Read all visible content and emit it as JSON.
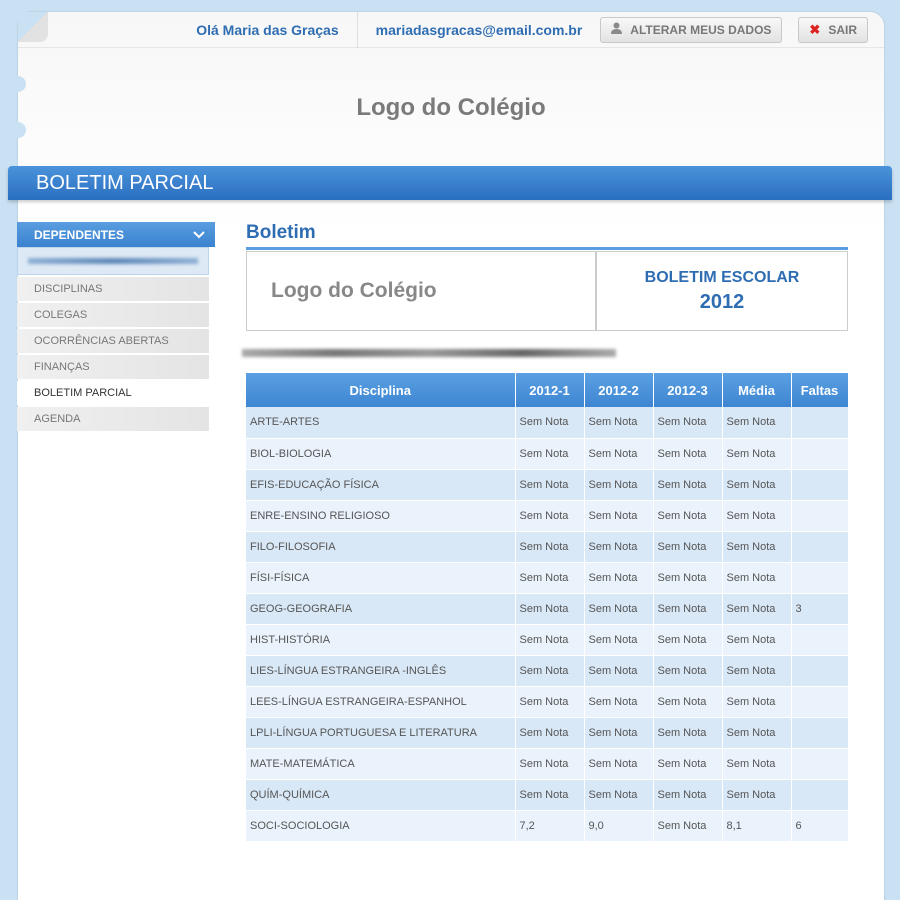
{
  "topbar": {
    "greeting": "Olá Maria das Graças",
    "email": "mariadasgracas@email.com.br",
    "edit_label": "ALTERAR MEUS DADOS",
    "exit_label": "SAIR",
    "edit_icon": "user-icon",
    "exit_icon": "close-icon"
  },
  "logo_text": "Logo do Colégio",
  "page_title": "BOLETIM PARCIAL",
  "sidebar": {
    "header": "DEPENDENTES",
    "items": [
      {
        "label": "DISCIPLINAS"
      },
      {
        "label": "COLEGAS"
      },
      {
        "label": "OCORRÊNCIAS ABERTAS"
      },
      {
        "label": "FINANÇAS"
      },
      {
        "label": "BOLETIM PARCIAL"
      },
      {
        "label": "AGENDA"
      }
    ],
    "active_index": 4
  },
  "main": {
    "title": "Boletim",
    "report_logo": "Logo do Colégio",
    "report_title": "BOLETIM ESCOLAR",
    "report_year": "2012"
  },
  "table": {
    "headers": [
      "Disciplina",
      "2012-1",
      "2012-2",
      "2012-3",
      "Média",
      "Faltas"
    ],
    "rows": [
      [
        "ARTE-ARTES",
        "Sem Nota",
        "Sem Nota",
        "Sem Nota",
        "Sem Nota",
        ""
      ],
      [
        "BIOL-BIOLOGIA",
        "Sem Nota",
        "Sem Nota",
        "Sem Nota",
        "Sem Nota",
        ""
      ],
      [
        "EFIS-EDUCAÇÃO FÍSICA",
        "Sem Nota",
        "Sem Nota",
        "Sem Nota",
        "Sem Nota",
        ""
      ],
      [
        "ENRE-ENSINO RELIGIOSO",
        "Sem Nota",
        "Sem Nota",
        "Sem Nota",
        "Sem Nota",
        ""
      ],
      [
        "FILO-FILOSOFIA",
        "Sem Nota",
        "Sem Nota",
        "Sem Nota",
        "Sem Nota",
        ""
      ],
      [
        "FÍSI-FÍSICA",
        "Sem Nota",
        "Sem Nota",
        "Sem Nota",
        "Sem Nota",
        ""
      ],
      [
        "GEOG-GEOGRAFIA",
        "Sem Nota",
        "Sem Nota",
        "Sem Nota",
        "Sem Nota",
        "3"
      ],
      [
        "HIST-HISTÓRIA",
        "Sem Nota",
        "Sem Nota",
        "Sem Nota",
        "Sem Nota",
        ""
      ],
      [
        "LIES-LÍNGUA ESTRANGEIRA -INGLÊS",
        "Sem Nota",
        "Sem Nota",
        "Sem Nota",
        "Sem Nota",
        ""
      ],
      [
        "LEES-LÍNGUA ESTRANGEIRA-ESPANHOL",
        "Sem Nota",
        "Sem Nota",
        "Sem Nota",
        "Sem Nota",
        ""
      ],
      [
        "LPLI-LÍNGUA PORTUGUESA E LITERATURA",
        "Sem Nota",
        "Sem Nota",
        "Sem Nota",
        "Sem Nota",
        ""
      ],
      [
        "MATE-MATEMÁTICA",
        "Sem Nota",
        "Sem Nota",
        "Sem Nota",
        "Sem Nota",
        ""
      ],
      [
        "QUÍM-QUÍMICA",
        "Sem Nota",
        "Sem Nota",
        "Sem Nota",
        "Sem Nota",
        ""
      ],
      [
        "SOCI-SOCIOLOGIA",
        "7,2",
        "9,0",
        "Sem Nota",
        "8,1",
        "6"
      ]
    ]
  }
}
